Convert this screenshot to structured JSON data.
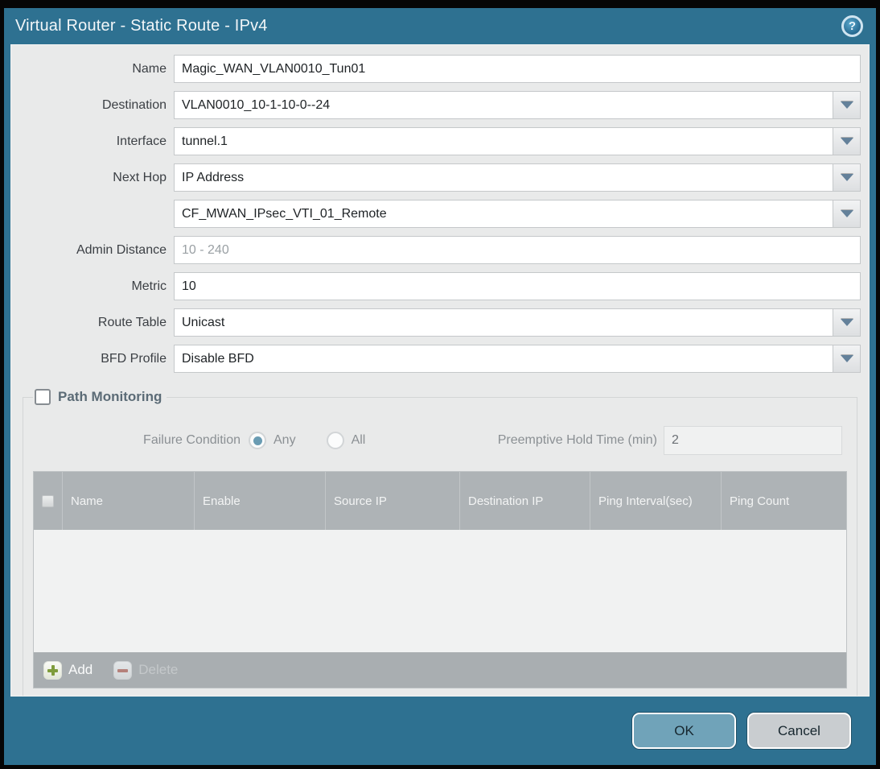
{
  "title": "Virtual Router - Static Route - IPv4",
  "help_icon_glyph": "?",
  "form": {
    "rows": [
      {
        "label": "Name",
        "value": "Magic_WAN_VLAN0010_Tun01"
      },
      {
        "label": "Destination",
        "value": "VLAN0010_10-1-10-0--24"
      },
      {
        "label": "Interface",
        "value": "tunnel.1"
      },
      {
        "label": "Next Hop",
        "value": "IP Address"
      },
      {
        "label": "",
        "value": "CF_MWAN_IPsec_VTI_01_Remote"
      },
      {
        "label": "Admin Distance",
        "value": "",
        "placeholder": "10 - 240"
      },
      {
        "label": "Metric",
        "value": "10"
      },
      {
        "label": "Route Table",
        "value": "Unicast"
      },
      {
        "label": "BFD Profile",
        "value": "Disable BFD"
      }
    ]
  },
  "path_monitoring": {
    "section_title": "Path Monitoring",
    "checkbox_checked": false,
    "failure_condition_label": "Failure Condition",
    "radio_any_label": "Any",
    "radio_all_label": "All",
    "radio_selected": "Any",
    "preemptive_label": "Preemptive Hold Time (min)",
    "preemptive_value": "2",
    "table": {
      "columns": [
        "Name",
        "Enable",
        "Source IP",
        "Destination IP",
        "Ping Interval(sec)",
        "Ping Count"
      ],
      "rows": [],
      "add_label": "Add",
      "delete_label": "Delete"
    }
  },
  "footer": {
    "ok_label": "OK",
    "cancel_label": "Cancel"
  },
  "colors": {
    "frame_teal": "#2e7191",
    "body_gray": "#e9eaea",
    "table_header_gray": "#aeb3b6",
    "ok_button": "#70a3b9",
    "cancel_button": "#c9cdd0",
    "add_plus_green": "#7f9c3b",
    "delete_minus_red": "#b5817b",
    "radio_dot_blue": "#6a9cb3"
  }
}
